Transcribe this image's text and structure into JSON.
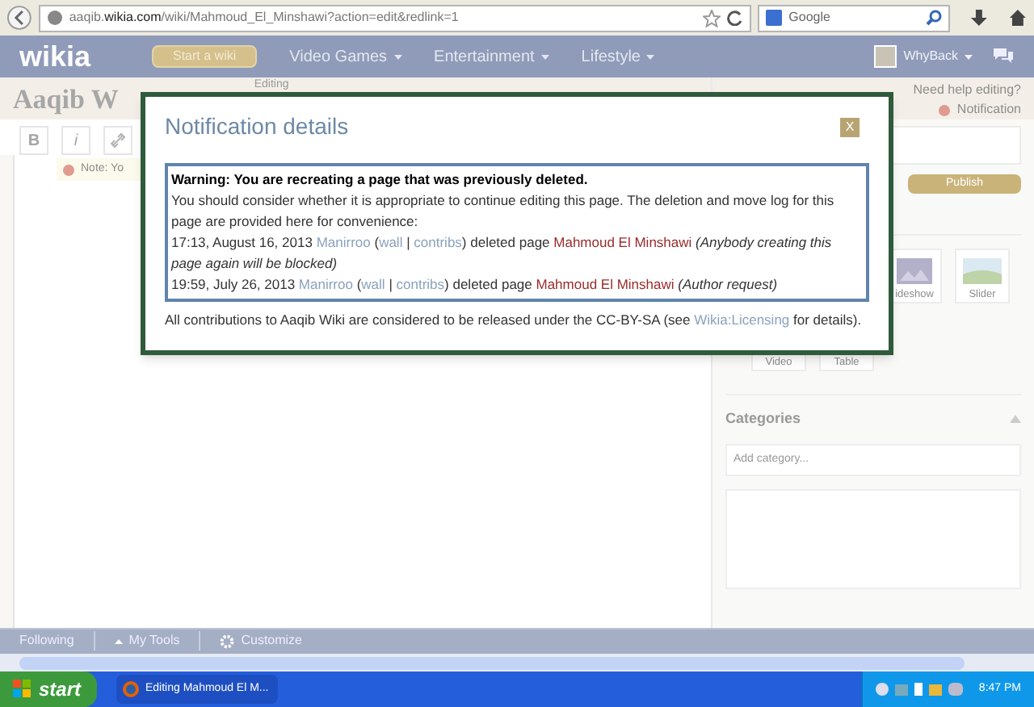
{
  "browser": {
    "url": "aaqib.**wikia.com**/wiki/Mahmoud_El_Minshawi?action=edit&redlink=1",
    "search_placeholder": "Google"
  },
  "nav": {
    "logo": "wikia",
    "start_button": "Start a wiki",
    "menus": [
      "Video Games",
      "Entertainment",
      "Lifestyle"
    ],
    "user": "WhyBack"
  },
  "header": {
    "wiki_name": "Aaqib W",
    "editing": "Editing",
    "help": "Need help editing?",
    "notification": "Notification"
  },
  "toolbar": {
    "buttons": [
      "B",
      "i"
    ],
    "note": "Note: Yo"
  },
  "sidebar": {
    "publish": "Publish",
    "media": [
      {
        "label": "ideshow",
        "kind": "slideshow"
      },
      {
        "label": "Slider",
        "kind": "slider"
      },
      {
        "label": "Video",
        "kind": "video"
      },
      {
        "label": "Table",
        "kind": "table"
      }
    ],
    "categories_title": "Categories",
    "category_placeholder": "Add category..."
  },
  "dialog": {
    "title": "Notification details",
    "close": "X",
    "warning_title": "Warning: You are recreating a page that was previously deleted.",
    "warning_text": "You should consider whether it is appropriate to continue editing this page. The deletion and move log for this page are provided here for convenience:",
    "log": [
      {
        "time": "17:13, August 16, 2013",
        "user": "Manirroo",
        "open": "(",
        "wall": "wall",
        "separator": "|",
        "contribs": "contribs",
        "close": ")",
        "action": "deleted page",
        "page": "Mahmoud El Minshawi",
        "reason": "(Anybody creating this page again will be blocked)"
      },
      {
        "time": "19:59, July 26, 2013",
        "user": "Manirroo",
        "open": "(",
        "wall": "wall",
        "separator": "|",
        "contribs": "contribs",
        "close": ")",
        "action": "deleted page",
        "page": "Mahmoud El Minshawi",
        "reason": "(Author request)"
      }
    ],
    "footer_before": "All contributions to Aaqib Wiki are considered to be released under the CC-BY-SA (see",
    "footer_link": "Wikia:Licensing",
    "footer_after": "for details)."
  },
  "bottom_bar": {
    "following": "Following",
    "my_tools": "My Tools",
    "customize": "Customize"
  },
  "taskbar": {
    "start": "start",
    "task": "Editing Mahmoud El M...",
    "clock": "8:47 PM"
  }
}
